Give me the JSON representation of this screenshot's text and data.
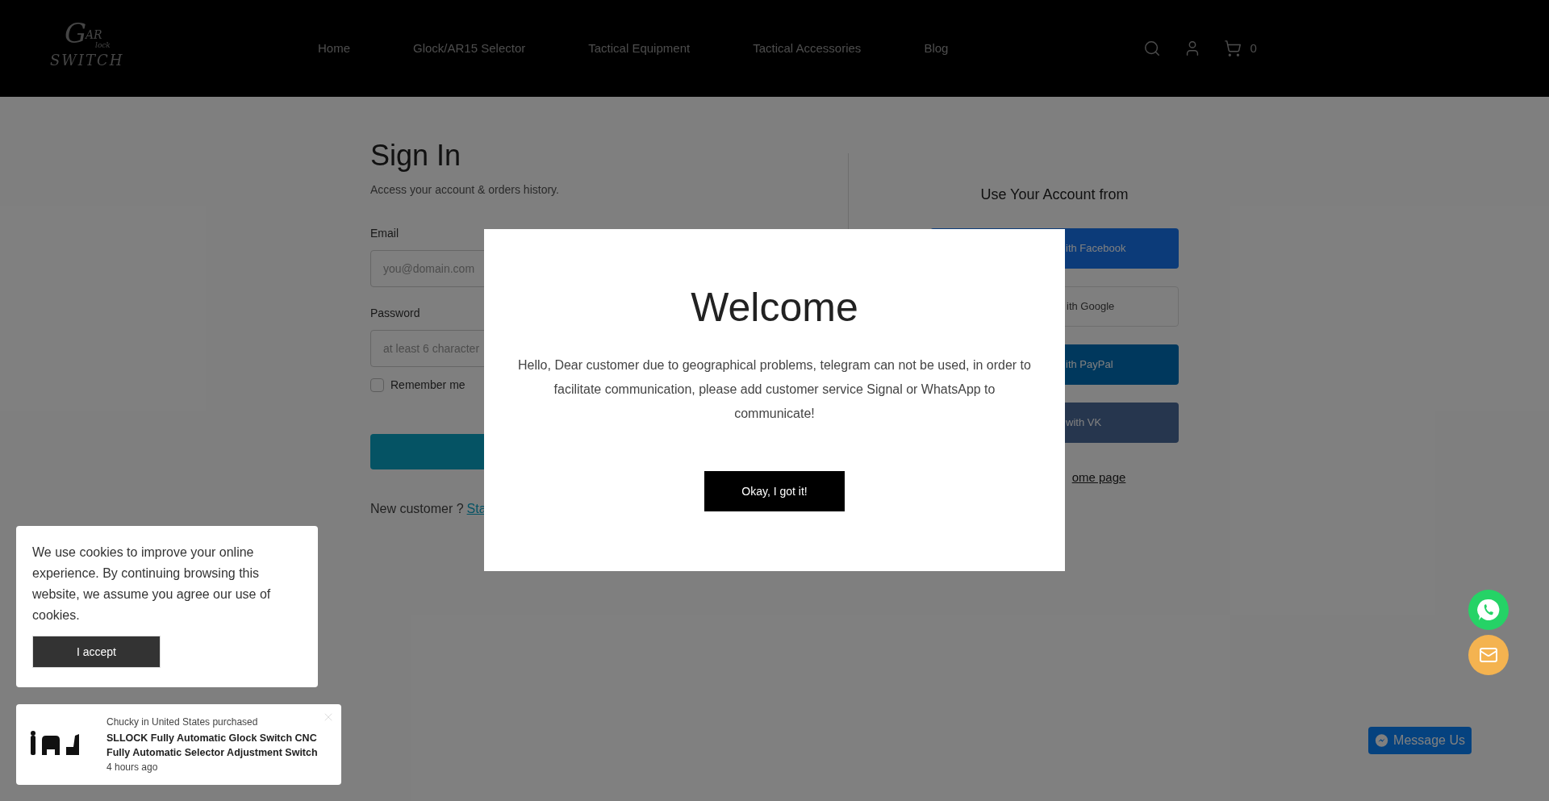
{
  "header": {
    "logo": {
      "initial": "G",
      "top": "AR",
      "middle": "lock",
      "bottom": "SWITCH"
    },
    "nav": [
      {
        "label": "Home"
      },
      {
        "label": "Glock/AR15 Selector"
      },
      {
        "label": "Tactical Equipment"
      },
      {
        "label": "Tactical Accessories"
      },
      {
        "label": "Blog"
      }
    ],
    "cart_count": "0"
  },
  "signin": {
    "title": "Sign In",
    "subtitle": "Access your account & orders history.",
    "email": {
      "label": "Email",
      "placeholder": "you@domain.com"
    },
    "password": {
      "label": "Password",
      "placeholder": "at least 6 character"
    },
    "remember": {
      "label": "Remember me",
      "checked": false
    },
    "new_customer": {
      "text": "New customer ?",
      "link": "Sta"
    }
  },
  "social": {
    "title": "Use Your Account from",
    "buttons": [
      {
        "kind": "facebook",
        "label": "ith Facebook"
      },
      {
        "kind": "google",
        "label": "ith Google"
      },
      {
        "kind": "paypal",
        "label": "ith PayPal"
      },
      {
        "kind": "vk",
        "label": "with VK"
      }
    ],
    "home_link": "ome page"
  },
  "modal": {
    "title": "Welcome",
    "body": "Hello, Dear customer due to geographical problems, telegram can not be used, in order to facilitate communication, please add customer service Signal or WhatsApp to communicate!",
    "button": "Okay, I got it!"
  },
  "cookie": {
    "text": "We use cookies to improve your online experience. By continuing browsing this website, we assume you agree our use of cookies.",
    "button": "I accept"
  },
  "notification": {
    "buyer": "Chucky in United States purchased",
    "product": "SLLOCK Fully Automatic Glock Switch CNC Fully Automatic Selector Adjustment Switch",
    "time": "4 hours ago"
  },
  "message_us": {
    "label": "Message Us"
  }
}
